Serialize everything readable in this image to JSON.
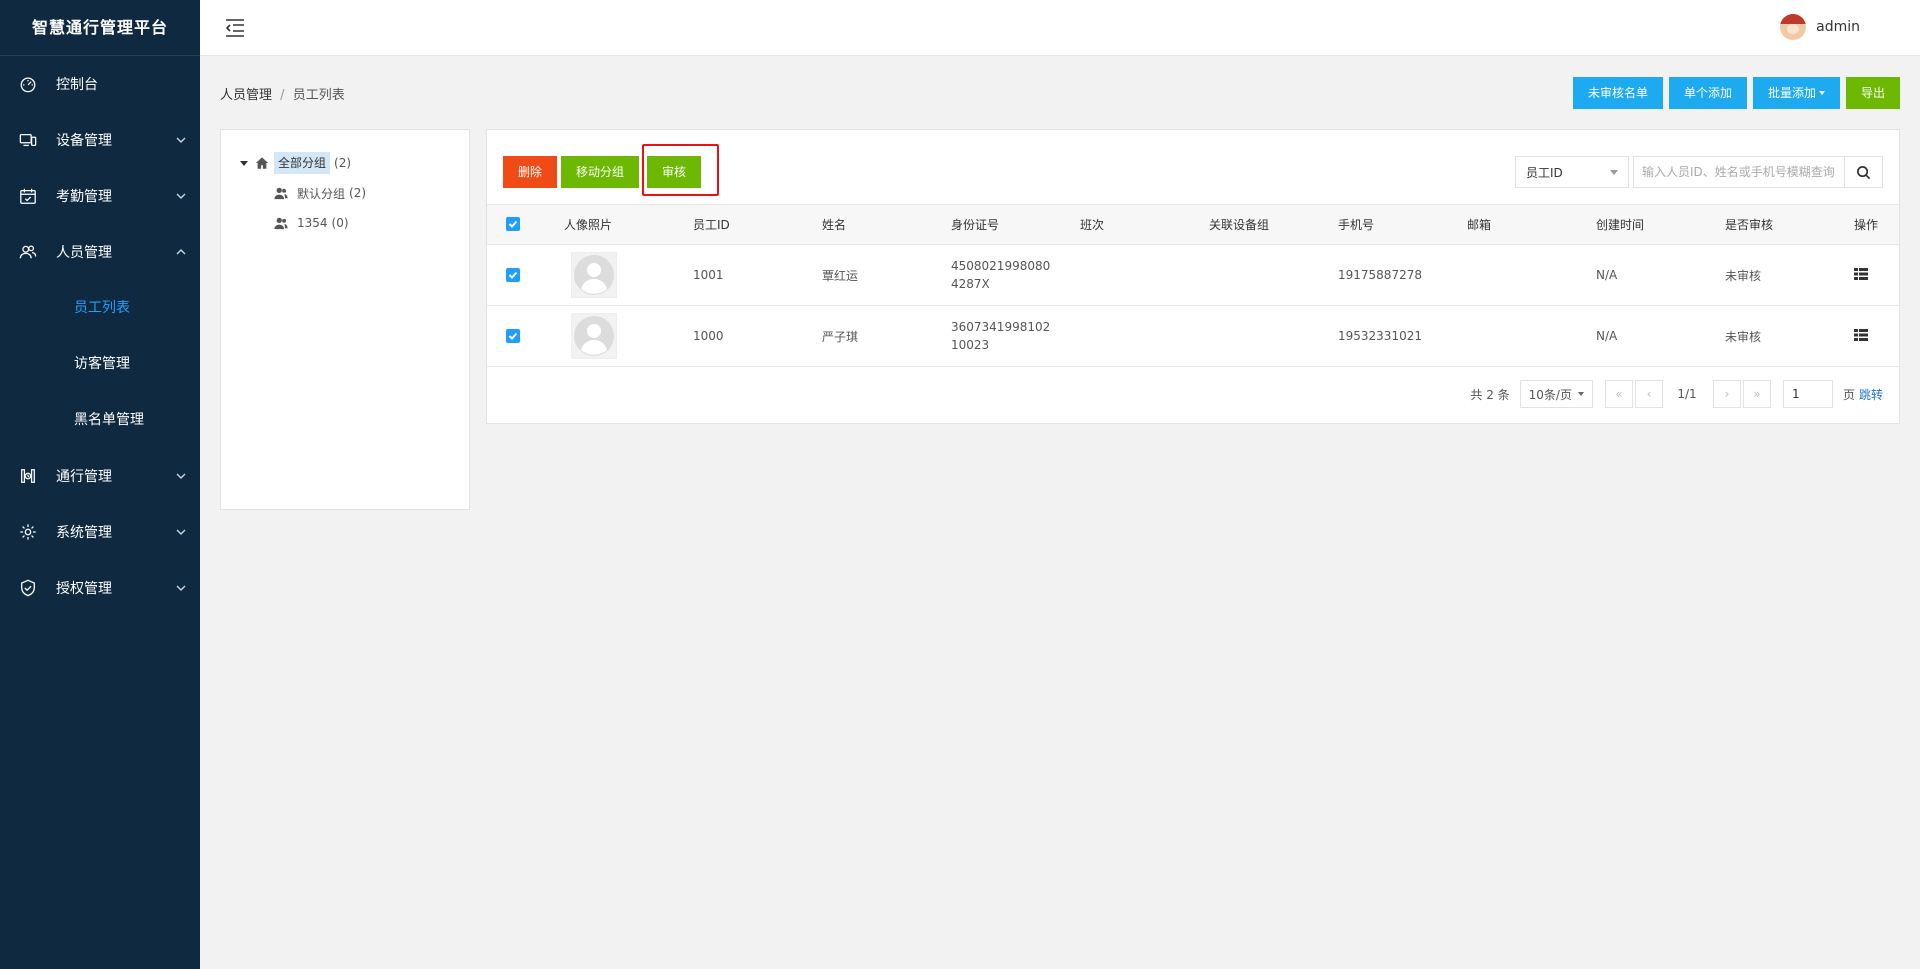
{
  "app": {
    "brand": "智慧通行管理平台"
  },
  "sidebar": {
    "items": [
      {
        "label": "控制台",
        "icon": "dashboard-icon",
        "has_chevron": false
      },
      {
        "label": "设备管理",
        "icon": "devices-icon",
        "has_chevron": true,
        "expanded": false
      },
      {
        "label": "考勤管理",
        "icon": "calendar-icon",
        "has_chevron": true,
        "expanded": false
      },
      {
        "label": "人员管理",
        "icon": "people-icon",
        "has_chevron": true,
        "expanded": true,
        "children": [
          {
            "label": "员工列表",
            "active": true
          },
          {
            "label": "访客管理",
            "active": false
          },
          {
            "label": "黑名单管理",
            "active": false
          }
        ]
      },
      {
        "label": "通行管理",
        "icon": "access-icon",
        "has_chevron": true,
        "expanded": false
      },
      {
        "label": "系统管理",
        "icon": "gear-icon",
        "has_chevron": true,
        "expanded": false
      },
      {
        "label": "授权管理",
        "icon": "shield-icon",
        "has_chevron": true,
        "expanded": false
      }
    ]
  },
  "header": {
    "username": "admin"
  },
  "breadcrumb": {
    "parent": "人员管理",
    "separator": "/",
    "current": "员工列表"
  },
  "top_actions": {
    "unreviewed": "未审核名单",
    "add_single": "单个添加",
    "add_batch": "批量添加",
    "export": "导出"
  },
  "tree": {
    "root": {
      "label": "全部分组",
      "count": "(2)"
    },
    "children": [
      {
        "label": "默认分组",
        "count": "(2)"
      },
      {
        "label": "1354",
        "count": "(0)"
      }
    ]
  },
  "toolbar": {
    "delete": "删除",
    "move_group": "移动分组",
    "review": "审核"
  },
  "search": {
    "field": "员工ID",
    "placeholder": "输入人员ID、姓名或手机号模糊查询"
  },
  "table": {
    "columns": [
      "人像照片",
      "员工ID",
      "姓名",
      "身份证号",
      "班次",
      "关联设备组",
      "手机号",
      "邮箱",
      "创建时间",
      "是否审核",
      "操作"
    ],
    "rows": [
      {
        "id": "1001",
        "name": "覃红运",
        "id_card_1": "4508021998080",
        "id_card_2": "4287X",
        "shift": "",
        "device_group": "",
        "phone": "19175887278",
        "email": "",
        "created": "N/A",
        "reviewed": "未审核"
      },
      {
        "id": "1000",
        "name": "严子琪",
        "id_card_1": "3607341998102",
        "id_card_2": "10023",
        "shift": "",
        "device_group": "",
        "phone": "19532331021",
        "email": "",
        "created": "N/A",
        "reviewed": "未审核"
      }
    ]
  },
  "pager": {
    "total": "共 2 条",
    "page_size": "10条/页",
    "first": "«",
    "prev": "‹",
    "info": "1/1",
    "next": "›",
    "last": "»",
    "goto_value": "1",
    "page_unit": "页",
    "jump": "跳转"
  },
  "colors": {
    "sidebar_bg": "#0f2a40",
    "accent_blue": "#1eaaf1",
    "accent_green": "#6cb802",
    "danger": "#f04b16",
    "active_menu": "#1e9fff",
    "highlight": "#e81414"
  }
}
